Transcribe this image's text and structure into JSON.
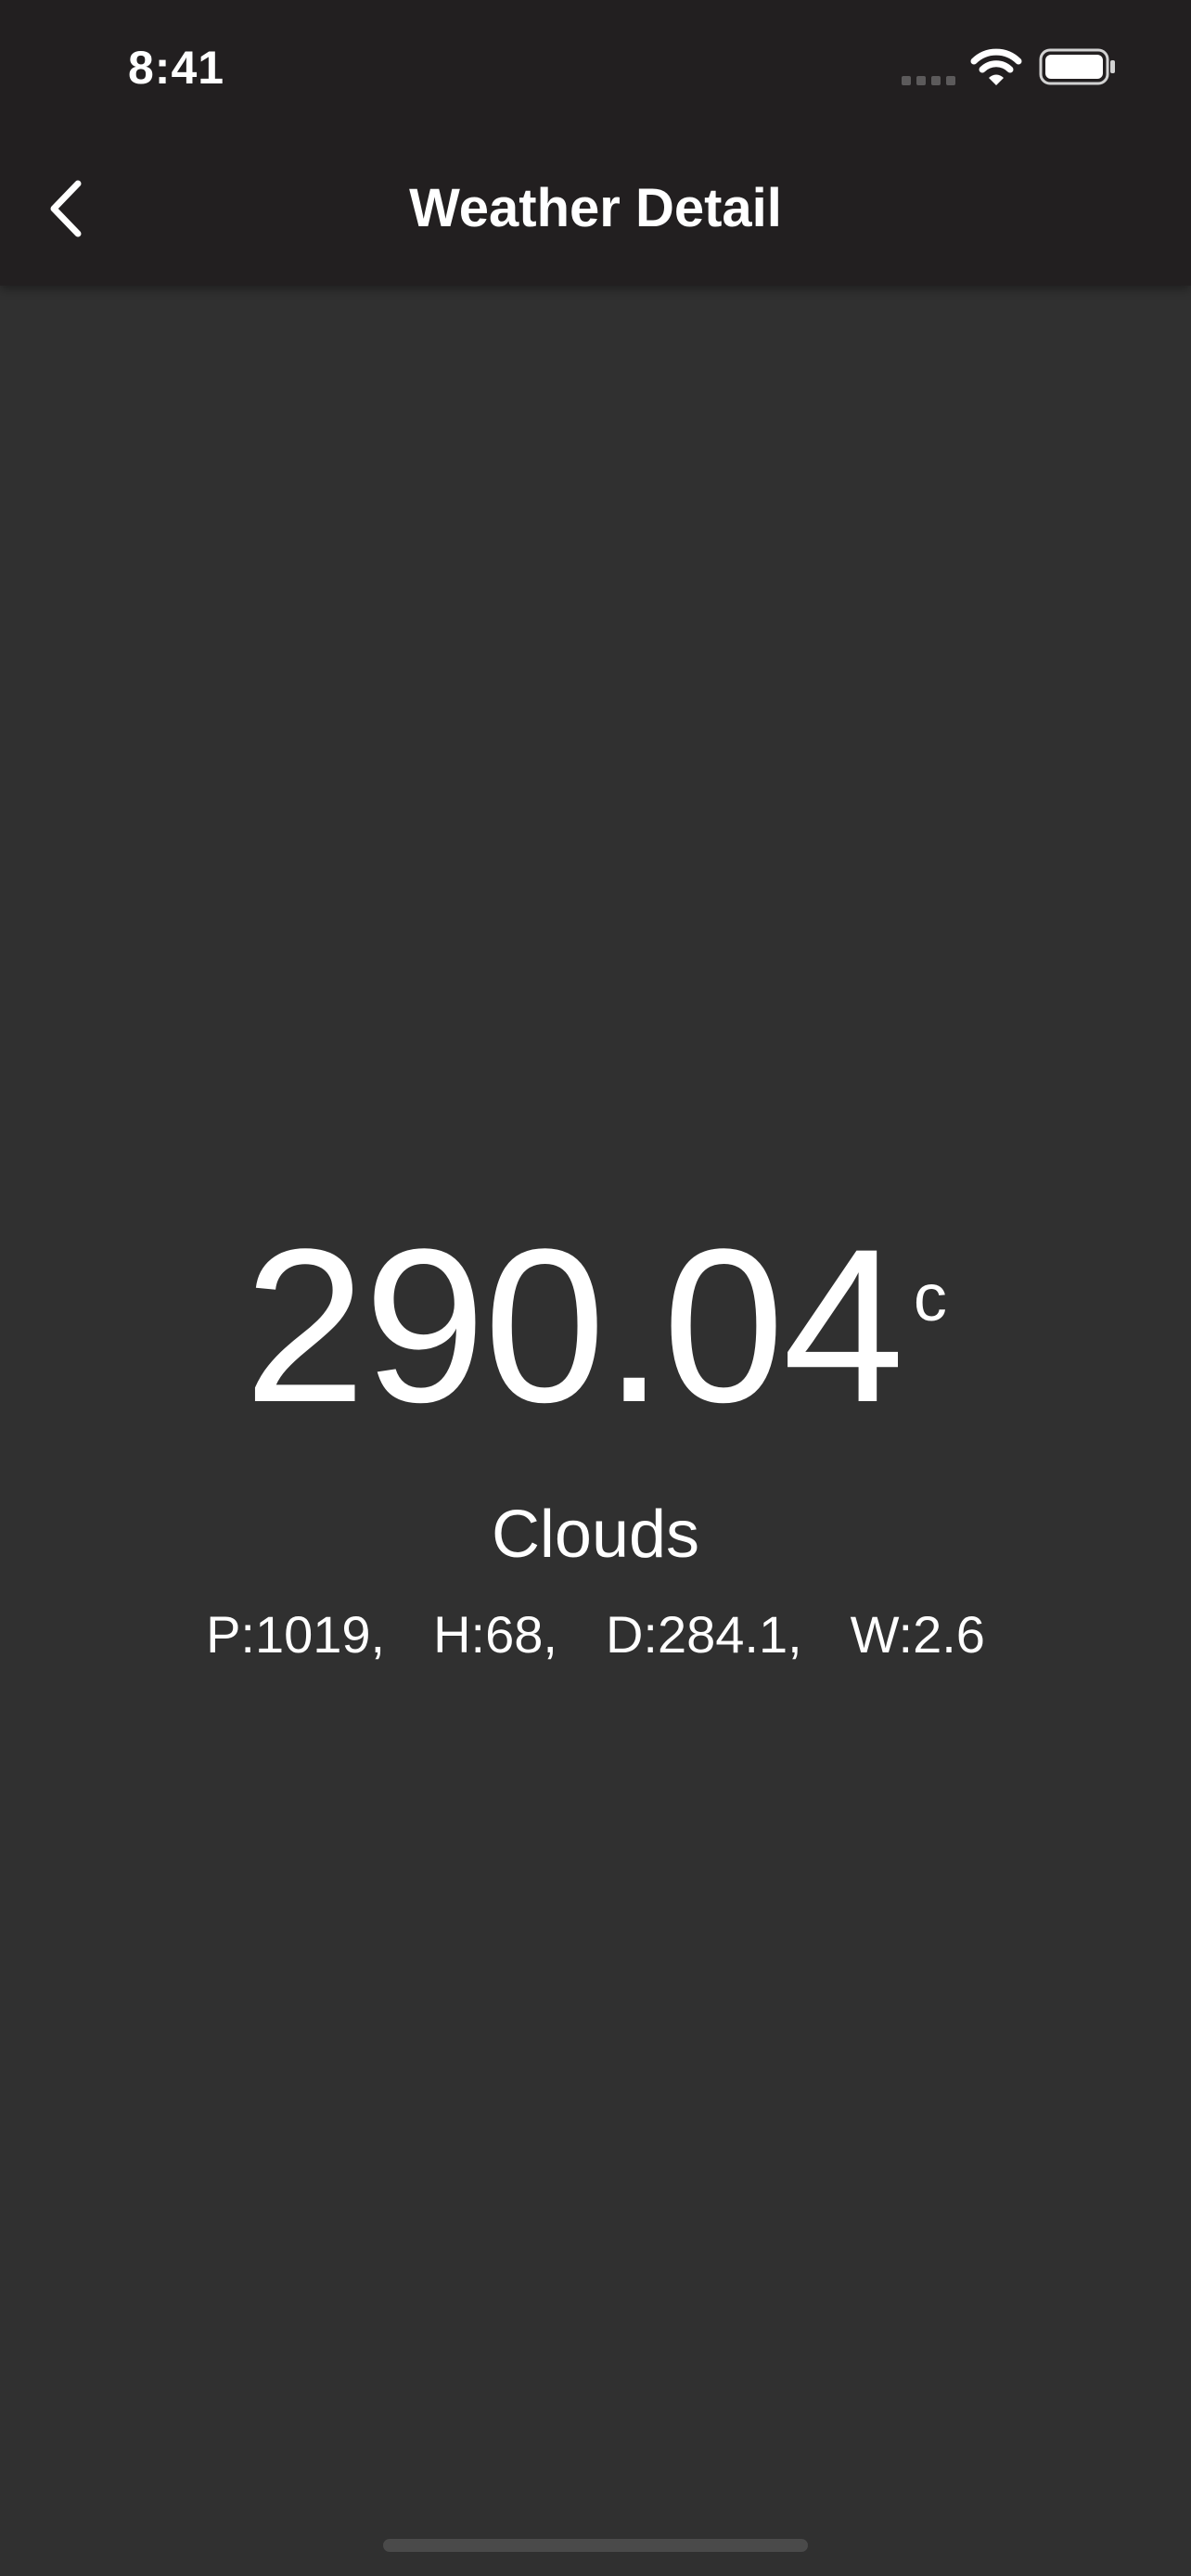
{
  "status_bar": {
    "time": "8:41",
    "icons": [
      "cellular-signal-icon",
      "wifi-icon",
      "battery-icon"
    ]
  },
  "app_bar": {
    "title": "Weather Detail",
    "back_icon": "chevron-left-icon"
  },
  "weather": {
    "temperature": "290.04",
    "unit": "c",
    "condition": "Clouds",
    "details": [
      {
        "text": "P:1019,"
      },
      {
        "text": "H:68,"
      },
      {
        "text": "D:284.1,"
      },
      {
        "text": "W:2.6"
      }
    ]
  },
  "colors": {
    "background": "#303030",
    "app_bar": "#221f20",
    "text": "#ffffff"
  }
}
